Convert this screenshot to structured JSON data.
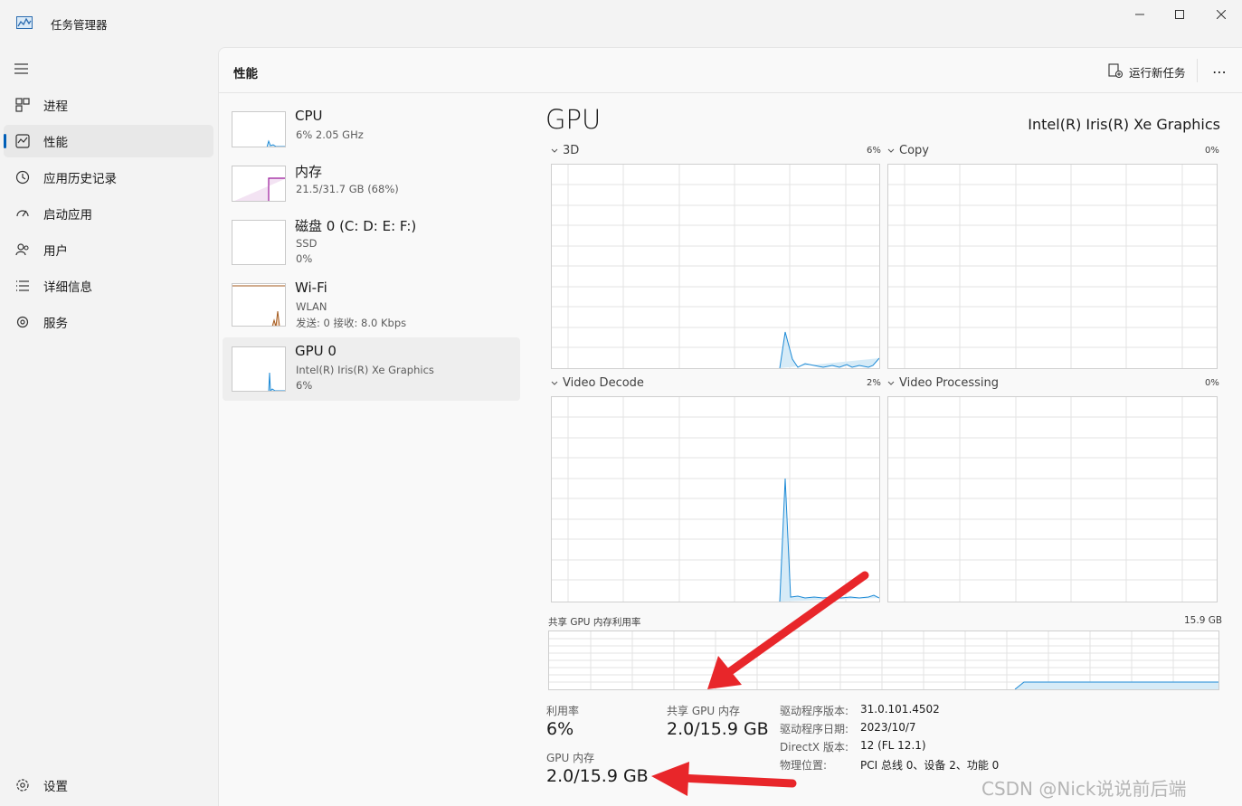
{
  "window": {
    "title": "任务管理器",
    "minimize_icon": "minimize-icon",
    "maximize_icon": "maximize-icon",
    "close_icon": "close-icon"
  },
  "sidebar": {
    "items": [
      {
        "label": "进程",
        "icon": "processes-icon"
      },
      {
        "label": "性能",
        "icon": "performance-icon",
        "active": true
      },
      {
        "label": "应用历史记录",
        "icon": "history-icon"
      },
      {
        "label": "启动应用",
        "icon": "startup-icon"
      },
      {
        "label": "用户",
        "icon": "users-icon"
      },
      {
        "label": "详细信息",
        "icon": "details-icon"
      },
      {
        "label": "服务",
        "icon": "services-icon"
      }
    ],
    "settings_label": "设置"
  },
  "header": {
    "title": "性能",
    "run_task": "运行新任务",
    "more": "⋯"
  },
  "devices": [
    {
      "name": "CPU",
      "sub1": "6% 2.05 GHz",
      "sub2": ""
    },
    {
      "name": "内存",
      "sub1": "21.5/31.7 GB (68%)",
      "sub2": ""
    },
    {
      "name": "磁盘 0 (C: D: E: F:)",
      "sub1": "SSD",
      "sub2": "0%"
    },
    {
      "name": "Wi-Fi",
      "sub1": "WLAN",
      "sub2": "发送: 0 接收: 8.0 Kbps"
    },
    {
      "name": "GPU 0",
      "sub1": "Intel(R) Iris(R) Xe Graphics",
      "sub2": "6%"
    }
  ],
  "gpu": {
    "title": "GPU",
    "model": "Intel(R) Iris(R) Xe Graphics",
    "engines": [
      {
        "label": "3D",
        "pct": "6%"
      },
      {
        "label": "Copy",
        "pct": "0%"
      },
      {
        "label": "Video Decode",
        "pct": "2%"
      },
      {
        "label": "Video Processing",
        "pct": "0%"
      }
    ],
    "shared_label": "共享 GPU 内存利用率",
    "shared_max": "15.9 GB",
    "stats": {
      "util_label": "利用率",
      "util_value": "6%",
      "shared_mem_label": "共享 GPU 内存",
      "shared_mem_value": "2.0/15.9 GB",
      "gpu_mem_label": "GPU 内存",
      "gpu_mem_value": "2.0/15.9 GB"
    },
    "info": [
      {
        "key": "驱动程序版本:",
        "value": "31.0.101.4502"
      },
      {
        "key": "驱动程序日期:",
        "value": "2023/10/7"
      },
      {
        "key": "DirectX 版本:",
        "value": "12 (FL 12.1)"
      },
      {
        "key": "物理位置:",
        "value": "PCI 总线 0、设备 2、功能 0"
      }
    ]
  },
  "watermark": "CSDN @Nick说说前后端",
  "colors": {
    "accent": "#005fb8",
    "gpu_line": "#1d8ad6",
    "annotation_arrow": "#e8262a"
  }
}
